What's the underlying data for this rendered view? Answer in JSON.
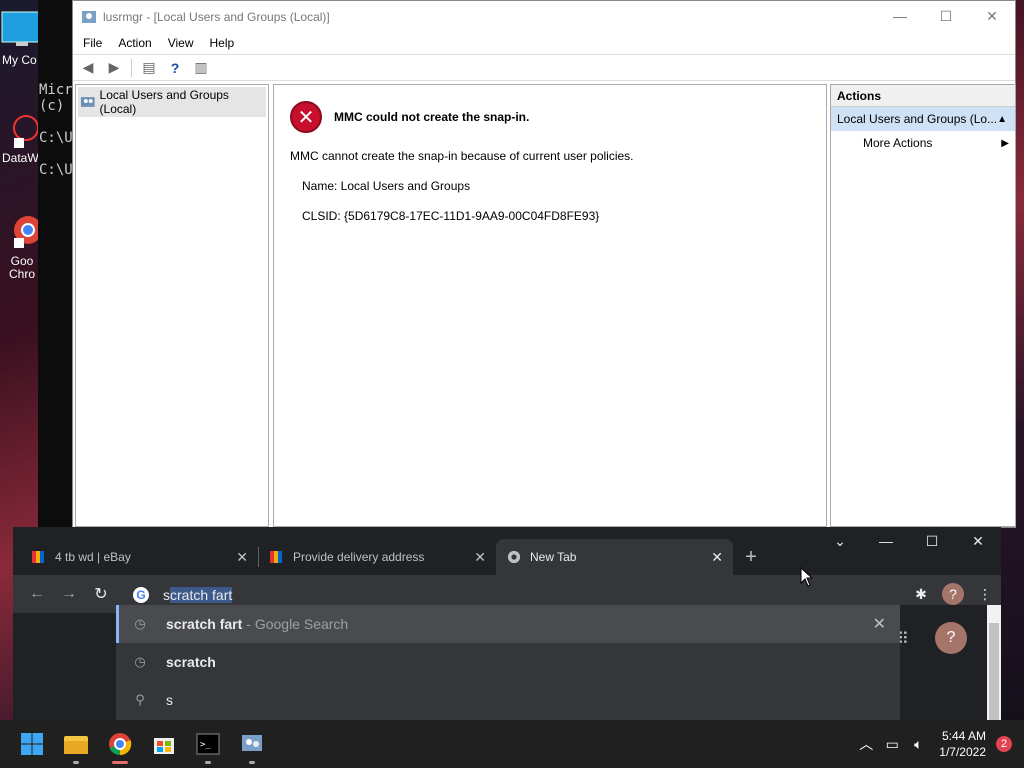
{
  "desktop": {
    "icons": [
      {
        "label": "My Co"
      },
      {
        "label": "DataW"
      },
      {
        "label": "Goo\nChro"
      }
    ],
    "cmd_lines": [
      "Micr",
      "(c)",
      "",
      "C:\\U",
      "",
      "C:\\U"
    ]
  },
  "mmc": {
    "title": "lusrmgr - [Local Users and Groups (Local)]",
    "menu": [
      "File",
      "Action",
      "View",
      "Help"
    ],
    "tree_item": "Local Users and Groups (Local)",
    "error_title": "MMC could not create the snap-in.",
    "message": "MMC cannot create the snap-in because of current user policies.",
    "name_line": "Name: Local Users and Groups",
    "clsid_line": "CLSID: {5D6179C8-17EC-11D1-9AA9-00C04FD8FE93}",
    "actions_header": "Actions",
    "actions_selected": "Local Users and Groups (Lo...",
    "actions_more": "More Actions"
  },
  "chrome": {
    "tabs": [
      {
        "title": "4 tb wd | eBay",
        "active": false
      },
      {
        "title": "Provide delivery address",
        "active": false
      },
      {
        "title": "New Tab",
        "active": true
      }
    ],
    "omnibox": {
      "typed": "s",
      "autocomplete": "cratch fart"
    },
    "suggestions": [
      {
        "bold": "s",
        "rest": "cratch fart",
        "suffix": "- Google Search",
        "icon": "history-icon"
      },
      {
        "bold": "s",
        "rest": "cratch",
        "suffix": "",
        "icon": "history-icon"
      },
      {
        "bold": "",
        "rest": "s",
        "suffix": "",
        "icon": "search-icon"
      }
    ]
  },
  "taskbar": {
    "time": "5:44 AM",
    "date": "1/7/2022",
    "notification_count": "2"
  }
}
